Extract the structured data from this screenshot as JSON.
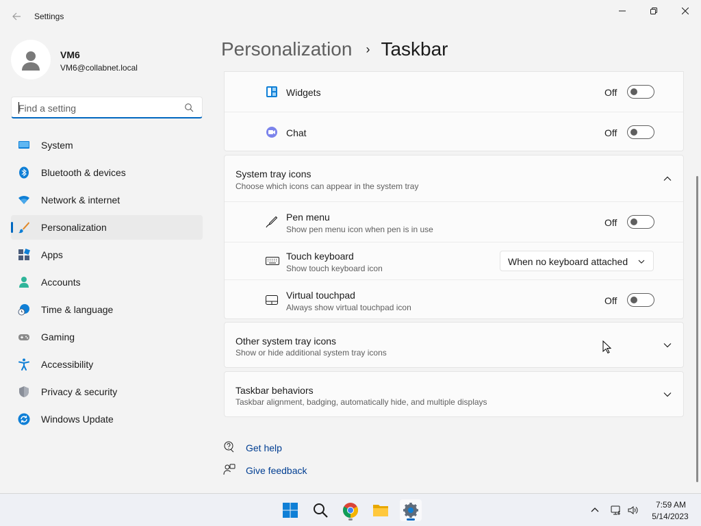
{
  "window": {
    "title": "Settings"
  },
  "user": {
    "name": "VM6",
    "email": "VM6@collabnet.local"
  },
  "search": {
    "placeholder": "Find a setting"
  },
  "sidebar": {
    "items": [
      {
        "label": "System",
        "icon": "system-icon"
      },
      {
        "label": "Bluetooth & devices",
        "icon": "bluetooth-icon"
      },
      {
        "label": "Network & internet",
        "icon": "wifi-icon"
      },
      {
        "label": "Personalization",
        "icon": "brush-icon",
        "active": true
      },
      {
        "label": "Apps",
        "icon": "apps-icon"
      },
      {
        "label": "Accounts",
        "icon": "accounts-icon"
      },
      {
        "label": "Time & language",
        "icon": "globe-clock-icon"
      },
      {
        "label": "Gaming",
        "icon": "gamepad-icon"
      },
      {
        "label": "Accessibility",
        "icon": "accessibility-icon"
      },
      {
        "label": "Privacy & security",
        "icon": "shield-icon"
      },
      {
        "label": "Windows Update",
        "icon": "update-icon"
      }
    ]
  },
  "breadcrumb": {
    "parent": "Personalization",
    "separator": "›",
    "current": "Taskbar"
  },
  "taskbar_items_card": {
    "rows": [
      {
        "title": "Widgets",
        "state": "Off",
        "icon": "widgets-icon"
      },
      {
        "title": "Chat",
        "state": "Off",
        "icon": "chat-icon"
      }
    ]
  },
  "system_tray_card": {
    "title": "System tray icons",
    "subtitle": "Choose which icons can appear in the system tray",
    "expanded": true,
    "rows": [
      {
        "title": "Pen menu",
        "subtitle": "Show pen menu icon when pen is in use",
        "state": "Off",
        "icon": "pen-icon"
      },
      {
        "title": "Touch keyboard",
        "subtitle": "Show touch keyboard icon",
        "value": "When no keyboard attached",
        "icon": "keyboard-icon"
      },
      {
        "title": "Virtual touchpad",
        "subtitle": "Always show virtual touchpad icon",
        "state": "Off",
        "icon": "touchpad-icon"
      }
    ]
  },
  "other_tray_card": {
    "title": "Other system tray icons",
    "subtitle": "Show or hide additional system tray icons"
  },
  "behaviors_card": {
    "title": "Taskbar behaviors",
    "subtitle": "Taskbar alignment, badging, automatically hide, and multiple displays"
  },
  "help": {
    "get_help": "Get help",
    "give_feedback": "Give feedback"
  },
  "taskbar": {
    "time": "7:59 AM",
    "date": "5/14/2023"
  },
  "colors": {
    "accent": "#0067c0",
    "link": "#003e92",
    "background": "#f3f3f3",
    "card": "#fbfbfb"
  }
}
